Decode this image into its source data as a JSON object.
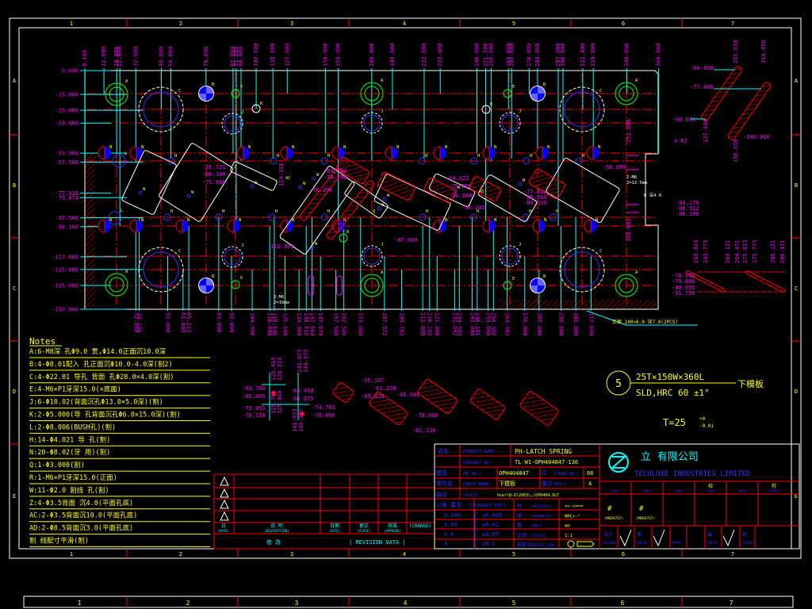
{
  "colors": {
    "background": "#000000",
    "frame": "#ffffff",
    "dimension": "#ff00ff",
    "extension_line": "#00ffff",
    "centerline": "#ff0000",
    "note_text": "#ffff00",
    "hole_fill": "#0000ff",
    "dowel": "#00ff00"
  },
  "frame": {
    "columns": [
      "1",
      "2",
      "3",
      "4",
      "5",
      "6",
      "7"
    ],
    "rows": [
      "A",
      "B",
      "C",
      "D",
      "E"
    ],
    "bottom_strip": [
      "1",
      "2",
      "3",
      "4",
      "5",
      "6",
      "7"
    ]
  },
  "drawing": {
    "top_dims": [
      "0.100",
      "12.000",
      "20.000",
      "22.000",
      "32.000",
      "48.000",
      "54.000",
      "76.000",
      "93.000",
      "95.000",
      "98.000",
      "107.500",
      "118.000",
      "127.000",
      "150.900",
      "159.000",
      "180.000",
      "193.000",
      "212.900",
      "223.000",
      "246.000",
      "251.500",
      "255.000",
      "265.800",
      "267.800",
      "278.800",
      "284.000",
      "297.000",
      "300.000",
      "312.400",
      "319.000",
      "340.000",
      "360.000"
    ],
    "left_dims": [
      "0.000",
      "-15.000",
      "-25.000",
      "-33.000",
      "-51.900",
      "-57.500",
      "-77.026",
      "-79.874",
      "-92.500",
      "-98.100",
      "-117.000",
      "-125.000",
      "-135.000",
      "-150.000"
    ],
    "bottom_dims": [
      "32.000",
      "34.136",
      "52.000",
      "61.600",
      "65.213",
      "84.000",
      "92.009",
      "104.996",
      "116.000",
      "118.836",
      "125.600",
      "134.380",
      "138.915",
      "142.560",
      "147.879",
      "157.500",
      "162.506",
      "173.000",
      "187.972",
      "198.782",
      "212.000",
      "216.282",
      "221.000",
      "232.042",
      "234.983",
      "243.000",
      "246.181",
      "253.000",
      "256.382",
      "264.983",
      "276.000",
      "285.000",
      "298.800",
      "308.000",
      "317.600"
    ],
    "hole_types": {
      "A": "A",
      "B": "B",
      "C": "C",
      "E": "E",
      "J": "J",
      "K": "K",
      "N": "N",
      "H": "H",
      "W": "W",
      "L": "L",
      "Z": "Z",
      "AC": "AC",
      "AD": "AD",
      "R": "R",
      "Q": "Q"
    },
    "inner_labels": [
      "-61.721",
      "-66.106",
      "-71.888",
      "-69.596",
      "-70.106",
      "-76.296",
      "-87.000",
      "-110.831",
      "124.318",
      "-60.000",
      "-83.178",
      "-88.922",
      "-90.100",
      "351.900",
      "320.063",
      "-77.822",
      "-80.564",
      "-89.539",
      "-64.622",
      "-79.290",
      "-90.888",
      "-86.243"
    ],
    "inner_notes": [
      "2-M6",
      "2=10mm",
      "2-M6",
      "2=12.5mm",
      "B 深4.0"
    ],
    "bottom_callout": "正面 100×6.0 深7.0(2PCS)",
    "side_labels": [
      "-60.406",
      "-77.406",
      "-98.016",
      "-109.016",
      "4-R2",
      "137.406",
      "156.658",
      "255.658",
      "314.456"
    ],
    "side2_labels": [
      "-78.595",
      "-79.806",
      "-90.655",
      "-91.756",
      "243.823",
      "243.773",
      "263.121",
      "264.471",
      "275.823",
      "275.773",
      "295.121",
      "296.471"
    ],
    "detail_labels": [
      "-63.700",
      "-65.865",
      "-73.453",
      "-76.118",
      "125.415",
      "126.314",
      "125.765",
      "125.464",
      "143.073",
      "144.472",
      "-64.450",
      "-66.675",
      "-74.783",
      "-76.868",
      "141.923",
      "143.327",
      "-55.197",
      "-61.258",
      "-69.878",
      "-65.961",
      "-78.000",
      "-82.128"
    ]
  },
  "spec": {
    "item_no": "5",
    "size": "25T×150W×360L",
    "material": "SLD,HRC 60 ±1°",
    "part": "下模板",
    "thickness": "T=25",
    "tol_plus": "+0",
    "tol_minus": "-0.01"
  },
  "notes": {
    "title": "Notes",
    "items": [
      "A:6-M8深 孔Φ9.0 贯,Φ14.0正面沉10.0深",
      "B:4-Φ8.01配入 孔正面沉Φ10.0-4.0深(割2)",
      "C:4-Φ22.01  导孔 背面 孔Φ28.0×4.0深(割)",
      "E:4-M6×P1牙深15.0(×底面)",
      "J:6-Φ10.02(背面沉孔Φ13.0×5.0深)(割)",
      "K:2-Φ5.000(导 孔背面沉孔Φ6.0×15.0深)(割)",
      "L:2-Φ8.006(BUSH孔)(割)",
      "H:14-Φ4.021 导 孔(割)",
      "N:20-Φ8.02(牙 用)(割)",
      "Q:1-Φ3.000(割)",
      "R:1-M6×P1牙深15.0(正面)",
      "W:11-Φ2.0 割线 孔(割)",
      "Z:4-Φ3.5背面 沉4.0(平面孔底)",
      "AC:2-Φ3.5背面沉10.0(平面孔底)",
      "AD:2-Φ8.5背面沉3.0(平面孔底)",
      "割 线配寸平滑(割)"
    ]
  },
  "revision": {
    "header": [
      "日",
      "说 明",
      "日期",
      "更正",
      "核准",
      "(CHANGE)"
    ],
    "header_en": [
      "(DATE)",
      "(DESCRIPTION)",
      "(DATE)",
      "(PLACE)",
      "(APPROVE)",
      ""
    ],
    "footer_cn": "修 改",
    "footer_en": "| REVISION  DATA |"
  },
  "title_block": {
    "product_name_label": "品名",
    "product_name_en": "(PRODUCT NAME)",
    "product_name": "PH-LATCH SPRING",
    "product_no_en": "(PRODUCT NO.)",
    "product_no": "TL-W1-OPH404847-136",
    "mold_label": "模具",
    "mold_en": "(MC NO.)",
    "mold_no": "OPH404847",
    "count_label": "件",
    "count_en": "(COUNT NO.)",
    "count": "06",
    "part_label": "零件名",
    "part_en": "(PARTS NAME)",
    "part_name": "下模板",
    "rev_label": "版次",
    "rev_en": "(REV.)",
    "rev": "A",
    "place_label": "路径",
    "place_en": "(PLACE)",
    "place": "User\\B-D\\2003\\…\\OPH404.DLT",
    "tol_label": "公差 要求",
    "tol_en": "(TOLERANCE SPEC)",
    "tolerances": [
      {
        "fmt": "X.XXX",
        "val": "±0.005"
      },
      {
        "fmt": "X.XX",
        "val": "±0.01"
      },
      {
        "fmt": "X.X",
        "val": "±0.05"
      },
      {
        "fmt": "X",
        "val": "±0.1"
      }
    ],
    "props": [
      {
        "cn": "材",
        "en": "(MATERIAL)",
        "val": "=>·<==="
      },
      {
        "cn": "硬",
        "en": "(HARDNESS)",
        "val": "HRC<-°"
      },
      {
        "cn": "数",
        "en": "(UNIT)",
        "val": "mm"
      },
      {
        "cn": "比例",
        "en": "(SCALE)",
        "val": "1:1"
      },
      {
        "cn": "投影法",
        "en": "(PROJECTION)",
        "val": ""
      }
    ],
    "company_cn": "立  有限公司",
    "company_en": "TECHLUXE INDUSTRIES LIMITED",
    "grid_header_cn": [
      "",
      "",
      "",
      "校",
      "",
      "符"
    ],
    "grid_header_en": [
      "(DSG)",
      "(DRG)",
      "(CHK)",
      "(APD)",
      "(MFG)",
      "(APPD)"
    ],
    "ids": [
      {
        "mark": "#",
        "code": "(MOD6767)"
      },
      {
        "mark": "#",
        "code": "(MOD6767)"
      }
    ],
    "signoffs": [
      {
        "cn": "设计",
        "en": "(DESIGN)"
      },
      {
        "cn": "审",
        "en": "(CHECK)"
      },
      {
        "cn": "",
        "en": "(APPR)"
      },
      {
        "cn": "省",
        "en": "(AUDIT)"
      },
      {
        "cn": "批",
        "en": "(ISSUE)"
      }
    ]
  }
}
